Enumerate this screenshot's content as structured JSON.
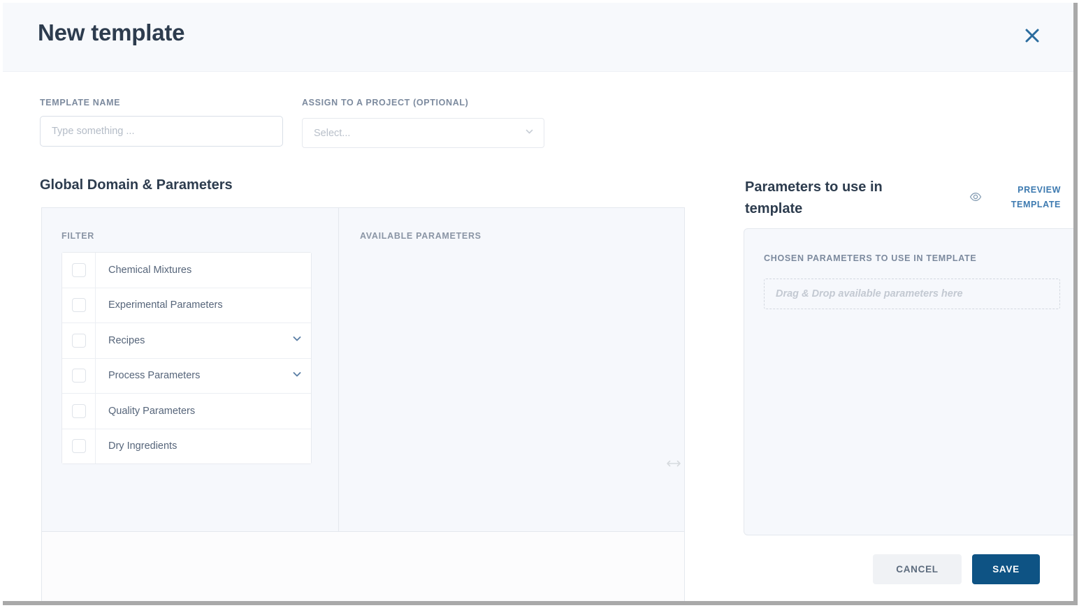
{
  "dialog": {
    "title": "New template",
    "close_icon": "close-icon"
  },
  "form": {
    "template_name": {
      "label": "TEMPLATE NAME",
      "value": "",
      "placeholder": "Type something ..."
    },
    "assign_project": {
      "label": "ASSIGN TO A PROJECT (OPTIONAL)",
      "selected": "Select...",
      "chevron_icon": "chevron-down-icon"
    }
  },
  "left": {
    "section_title": "Global Domain & Parameters",
    "filter_header": "FILTER",
    "available_header": "AVAILABLE PARAMETERS",
    "filters": [
      {
        "label": "Chemical Mixtures",
        "checked": false,
        "expandable": false
      },
      {
        "label": "Experimental Parameters",
        "checked": false,
        "expandable": false
      },
      {
        "label": "Recipes",
        "checked": false,
        "expandable": true
      },
      {
        "label": "Process Parameters",
        "checked": false,
        "expandable": true
      },
      {
        "label": "Quality Parameters",
        "checked": false,
        "expandable": false
      },
      {
        "label": "Dry Ingredients",
        "checked": false,
        "expandable": false
      }
    ],
    "available_items": []
  },
  "resize": {
    "icon": "horizontal-resize-icon"
  },
  "right": {
    "section_title": "Parameters to use in template",
    "preview_label": "PREVIEW TEMPLATE",
    "preview_icon": "eye-icon",
    "chosen_header": "CHOSEN PARAMETERS TO USE IN TEMPLATE",
    "dropzone_text": "Drag & Drop available parameters here",
    "chosen_items": []
  },
  "footer": {
    "cancel_label": "CANCEL",
    "save_label": "SAVE"
  },
  "colors": {
    "accent": "#0e5384",
    "link": "#3d7ab0",
    "panel_bg": "#f6f8fc",
    "header_bg": "#f7f9fc",
    "title_text": "#2d3c4e",
    "muted_text": "#7c8a9e"
  }
}
